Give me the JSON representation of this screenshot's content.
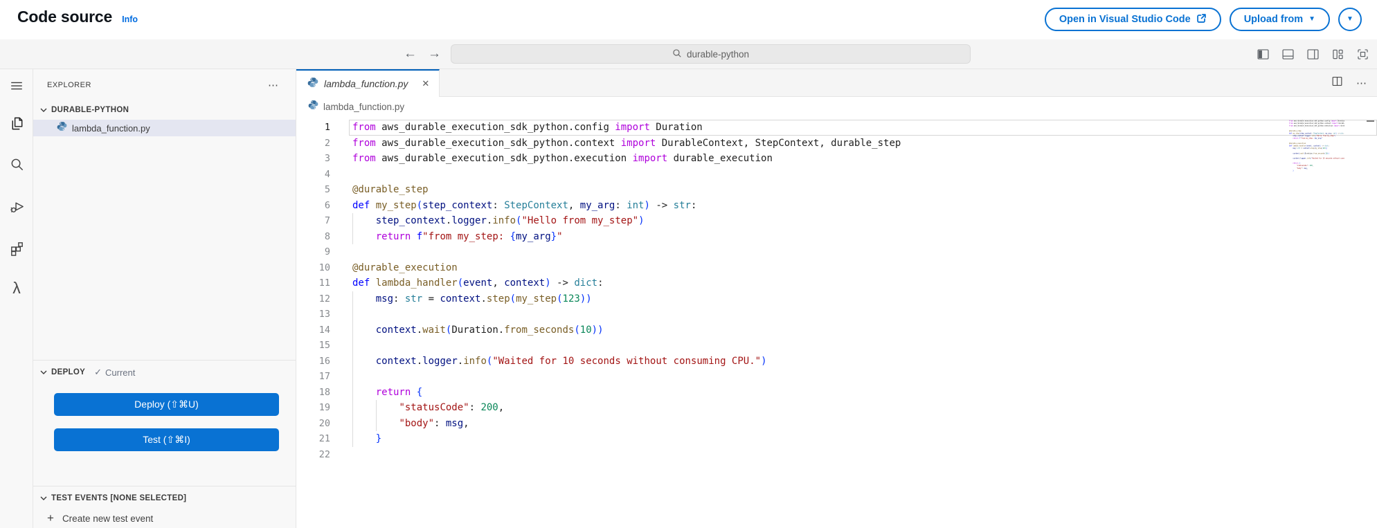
{
  "page": {
    "title": "Code source",
    "info_link": "Info"
  },
  "header_actions": {
    "open_vscode_label": "Open in Visual Studio Code",
    "upload_from_label": "Upload from",
    "caret_glyph": "▼"
  },
  "toolbar": {
    "back_glyph": "←",
    "forward_glyph": "→",
    "search_value": "durable-python",
    "layout_icon_names": [
      "toggle-primary-sidebar",
      "toggle-panel",
      "toggle-secondary-sidebar",
      "customize-layout",
      "maximize"
    ]
  },
  "activity_bar": {
    "icon_names": [
      "menu",
      "explorer",
      "search",
      "run-and-debug",
      "extensions",
      "aws-lambda"
    ],
    "lambda_glyph": "λ"
  },
  "explorer": {
    "header": "EXPLORER",
    "more_glyph": "⋯",
    "workspace": "DURABLE-PYTHON",
    "file": "lambda_function.py"
  },
  "deploy": {
    "header": "DEPLOY",
    "check_glyph": "✓",
    "status": "Current",
    "deploy_button": "Deploy (⇧⌘U)",
    "test_button": "Test (⇧⌘I)"
  },
  "test_events": {
    "header": "TEST EVENTS [NONE SELECTED]",
    "plus_glyph": "+",
    "create_label": "Create new test event"
  },
  "editor": {
    "tab_label": "lambda_function.py",
    "tab_close_glyph": "✕",
    "tab_more_glyph": "⋯",
    "breadcrumb": "lambda_function.py",
    "code_lines": [
      {
        "n": 1,
        "guides": 0,
        "active": true,
        "tokens": [
          [
            "kw",
            "from"
          ],
          [
            "pl",
            " aws_durable_execution_sdk_python.config "
          ],
          [
            "kw",
            "import"
          ],
          [
            "pl",
            " Duration"
          ]
        ]
      },
      {
        "n": 2,
        "guides": 0,
        "tokens": [
          [
            "kw",
            "from"
          ],
          [
            "pl",
            " aws_durable_execution_sdk_python.context "
          ],
          [
            "kw",
            "import"
          ],
          [
            "pl",
            " DurableContext, StepContext, durable_step"
          ]
        ]
      },
      {
        "n": 3,
        "guides": 0,
        "tokens": [
          [
            "kw",
            "from"
          ],
          [
            "pl",
            " aws_durable_execution_sdk_python.execution "
          ],
          [
            "kw",
            "import"
          ],
          [
            "pl",
            " durable_execution"
          ]
        ]
      },
      {
        "n": 4,
        "guides": 0,
        "tokens": []
      },
      {
        "n": 5,
        "guides": 0,
        "tokens": [
          [
            "fn",
            "@durable_step"
          ]
        ]
      },
      {
        "n": 6,
        "guides": 0,
        "tokens": [
          [
            "def",
            "def "
          ],
          [
            "fn",
            "my_step"
          ],
          [
            "brk",
            "("
          ],
          [
            "var",
            "step_context"
          ],
          [
            "pl",
            ": "
          ],
          [
            "typ",
            "StepContext"
          ],
          [
            "pl",
            ", "
          ],
          [
            "var",
            "my_arg"
          ],
          [
            "pl",
            ": "
          ],
          [
            "typ",
            "int"
          ],
          [
            "brk",
            ")"
          ],
          [
            "pl",
            " -> "
          ],
          [
            "typ",
            "str"
          ],
          [
            "pl",
            ":"
          ]
        ]
      },
      {
        "n": 7,
        "guides": 1,
        "tokens": [
          [
            "pl",
            "    "
          ],
          [
            "var",
            "step_context"
          ],
          [
            "pl",
            "."
          ],
          [
            "var",
            "logger"
          ],
          [
            "pl",
            "."
          ],
          [
            "fn",
            "info"
          ],
          [
            "brk",
            "("
          ],
          [
            "str",
            "\"Hello from my_step\""
          ],
          [
            "brk",
            ")"
          ]
        ]
      },
      {
        "n": 8,
        "guides": 1,
        "tokens": [
          [
            "pl",
            "    "
          ],
          [
            "kw",
            "return"
          ],
          [
            "pl",
            " "
          ],
          [
            "def",
            "f"
          ],
          [
            "str",
            "\"from my_step: "
          ],
          [
            "brk",
            "{"
          ],
          [
            "var",
            "my_arg"
          ],
          [
            "brk",
            "}"
          ],
          [
            "str",
            "\""
          ]
        ]
      },
      {
        "n": 9,
        "guides": 0,
        "tokens": []
      },
      {
        "n": 10,
        "guides": 0,
        "tokens": [
          [
            "fn",
            "@durable_execution"
          ]
        ]
      },
      {
        "n": 11,
        "guides": 0,
        "tokens": [
          [
            "def",
            "def "
          ],
          [
            "fn",
            "lambda_handler"
          ],
          [
            "brk",
            "("
          ],
          [
            "var",
            "event"
          ],
          [
            "pl",
            ", "
          ],
          [
            "var",
            "context"
          ],
          [
            "brk",
            ")"
          ],
          [
            "pl",
            " -> "
          ],
          [
            "typ",
            "dict"
          ],
          [
            "pl",
            ":"
          ]
        ]
      },
      {
        "n": 12,
        "guides": 1,
        "tokens": [
          [
            "pl",
            "    "
          ],
          [
            "var",
            "msg"
          ],
          [
            "pl",
            ": "
          ],
          [
            "typ",
            "str"
          ],
          [
            "pl",
            " = "
          ],
          [
            "var",
            "context"
          ],
          [
            "pl",
            "."
          ],
          [
            "fn",
            "step"
          ],
          [
            "brk",
            "("
          ],
          [
            "fn",
            "my_step"
          ],
          [
            "brk",
            "("
          ],
          [
            "num",
            "123"
          ],
          [
            "brk",
            "))"
          ]
        ]
      },
      {
        "n": 13,
        "guides": 1,
        "tokens": []
      },
      {
        "n": 14,
        "guides": 1,
        "tokens": [
          [
            "pl",
            "    "
          ],
          [
            "var",
            "context"
          ],
          [
            "pl",
            "."
          ],
          [
            "fn",
            "wait"
          ],
          [
            "brk",
            "("
          ],
          [
            "pl",
            "Duration."
          ],
          [
            "fn",
            "from_seconds"
          ],
          [
            "brk",
            "("
          ],
          [
            "num",
            "10"
          ],
          [
            "brk",
            "))"
          ]
        ]
      },
      {
        "n": 15,
        "guides": 1,
        "tokens": []
      },
      {
        "n": 16,
        "guides": 1,
        "tokens": [
          [
            "pl",
            "    "
          ],
          [
            "var",
            "context"
          ],
          [
            "pl",
            "."
          ],
          [
            "var",
            "logger"
          ],
          [
            "pl",
            "."
          ],
          [
            "fn",
            "info"
          ],
          [
            "brk",
            "("
          ],
          [
            "str",
            "\"Waited for 10 seconds without consuming CPU.\""
          ],
          [
            "brk",
            ")"
          ]
        ]
      },
      {
        "n": 17,
        "guides": 1,
        "tokens": []
      },
      {
        "n": 18,
        "guides": 1,
        "tokens": [
          [
            "pl",
            "    "
          ],
          [
            "kw",
            "return"
          ],
          [
            "pl",
            " "
          ],
          [
            "brk",
            "{"
          ]
        ]
      },
      {
        "n": 19,
        "guides": 2,
        "tokens": [
          [
            "pl",
            "        "
          ],
          [
            "str",
            "\"statusCode\""
          ],
          [
            "pl",
            ": "
          ],
          [
            "num",
            "200"
          ],
          [
            "pl",
            ","
          ]
        ]
      },
      {
        "n": 20,
        "guides": 2,
        "tokens": [
          [
            "pl",
            "        "
          ],
          [
            "str",
            "\"body\""
          ],
          [
            "pl",
            ": "
          ],
          [
            "var",
            "msg"
          ],
          [
            "pl",
            ","
          ]
        ]
      },
      {
        "n": 21,
        "guides": 1,
        "tokens": [
          [
            "pl",
            "    "
          ],
          [
            "brk",
            "}"
          ]
        ]
      },
      {
        "n": 22,
        "guides": 0,
        "tokens": []
      }
    ]
  },
  "colors": {
    "aws_accent": "#0972d3",
    "tab_accent": "#005fb8",
    "selection_bg": "#e4e6f1",
    "toolbar_bg": "#f5f5f5",
    "sidebar_bg": "#f8f8f8"
  }
}
